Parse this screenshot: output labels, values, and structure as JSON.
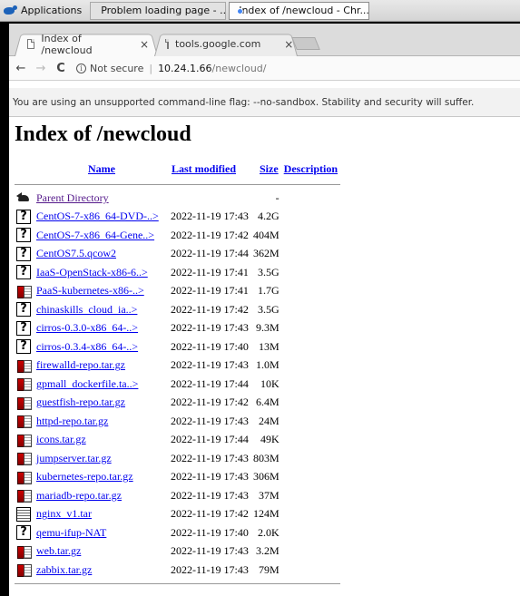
{
  "taskbar": {
    "apps_label": "Applications",
    "tasks": [
      {
        "label": "Problem loading page - ..."
      },
      {
        "label": "Index of /newcloud - Chr..."
      }
    ]
  },
  "browser": {
    "tabs": [
      {
        "title": "Index of /newcloud",
        "close": "×"
      },
      {
        "title": "tools.google.com",
        "close": "×"
      }
    ],
    "toolbar": {
      "back": "←",
      "forward": "→",
      "reload": "C",
      "security_label": "Not secure",
      "url_host": "10.24.1.66",
      "url_path": "/newcloud/"
    },
    "infobar_text": "You are using an unsupported command-line flag: --no-sandbox. Stability and security will suffer."
  },
  "page": {
    "title": "Index of /newcloud",
    "columns": {
      "name": "Name",
      "last_modified": "Last modified",
      "size": "Size",
      "description": "Description"
    },
    "parent": {
      "name": "Parent Directory",
      "size": "-"
    },
    "files": [
      {
        "icon": "unknown-file-icon",
        "name": "CentOS-7-x86_64-DVD-..>",
        "modified": "2022-11-19 17:43",
        "size": "4.2G"
      },
      {
        "icon": "unknown-file-icon",
        "name": "CentOS-7-x86_64-Gene..>",
        "modified": "2022-11-19 17:42",
        "size": "404M"
      },
      {
        "icon": "unknown-file-icon",
        "name": "CentOS7.5.qcow2",
        "modified": "2022-11-19 17:44",
        "size": "362M"
      },
      {
        "icon": "unknown-file-icon",
        "name": "IaaS-OpenStack-x86-6..>",
        "modified": "2022-11-19 17:41",
        "size": "3.5G"
      },
      {
        "icon": "archive-icon",
        "name": "PaaS-kubernetes-x86-..>",
        "modified": "2022-11-19 17:41",
        "size": "1.7G"
      },
      {
        "icon": "unknown-file-icon",
        "name": "chinaskills_cloud_ia..>",
        "modified": "2022-11-19 17:42",
        "size": "3.5G"
      },
      {
        "icon": "unknown-file-icon",
        "name": "cirros-0.3.0-x86_64-..>",
        "modified": "2022-11-19 17:43",
        "size": "9.3M"
      },
      {
        "icon": "unknown-file-icon",
        "name": "cirros-0.3.4-x86_64-..>",
        "modified": "2022-11-19 17:40",
        "size": "13M"
      },
      {
        "icon": "archive-icon",
        "name": "firewalld-repo.tar.gz",
        "modified": "2022-11-19 17:43",
        "size": "1.0M"
      },
      {
        "icon": "archive-icon",
        "name": "gpmall_dockerfile.ta..>",
        "modified": "2022-11-19 17:44",
        "size": "10K"
      },
      {
        "icon": "archive-icon",
        "name": "guestfish-repo.tar.gz",
        "modified": "2022-11-19 17:42",
        "size": "6.4M"
      },
      {
        "icon": "archive-icon",
        "name": "httpd-repo.tar.gz",
        "modified": "2022-11-19 17:43",
        "size": "24M"
      },
      {
        "icon": "archive-icon",
        "name": "icons.tar.gz",
        "modified": "2022-11-19 17:44",
        "size": "49K"
      },
      {
        "icon": "archive-icon",
        "name": "jumpserver.tar.gz",
        "modified": "2022-11-19 17:43",
        "size": "803M"
      },
      {
        "icon": "archive-icon",
        "name": "kubernetes-repo.tar.gz",
        "modified": "2022-11-19 17:43",
        "size": "306M"
      },
      {
        "icon": "archive-icon",
        "name": "mariadb-repo.tar.gz",
        "modified": "2022-11-19 17:43",
        "size": "37M"
      },
      {
        "icon": "tar-icon",
        "name": "nginx_v1.tar",
        "modified": "2022-11-19 17:42",
        "size": "124M"
      },
      {
        "icon": "unknown-file-icon",
        "name": "qemu-ifup-NAT",
        "modified": "2022-11-19 17:40",
        "size": "2.0K"
      },
      {
        "icon": "archive-icon",
        "name": "web.tar.gz",
        "modified": "2022-11-19 17:43",
        "size": "3.2M"
      },
      {
        "icon": "archive-icon",
        "name": "zabbix.tar.gz",
        "modified": "2022-11-19 17:43",
        "size": "79M"
      }
    ]
  }
}
